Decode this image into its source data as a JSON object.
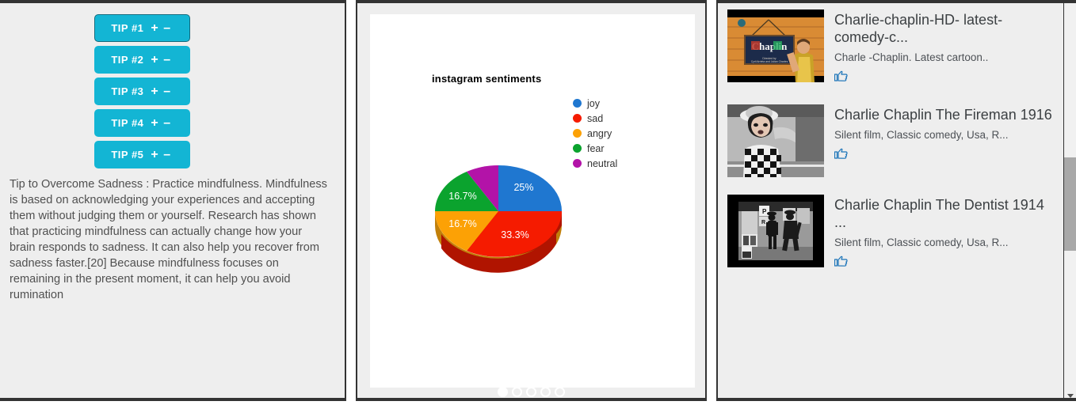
{
  "left_panel": {
    "tip_buttons": [
      {
        "label": "TIP #1",
        "plus": "+",
        "minus": "–",
        "focused": true
      },
      {
        "label": "TIP #2",
        "plus": "+",
        "minus": "–",
        "focused": false
      },
      {
        "label": "TIP #3",
        "plus": "+",
        "minus": "–",
        "focused": false
      },
      {
        "label": "TIP #4",
        "plus": "+",
        "minus": "–",
        "focused": false
      },
      {
        "label": "TIP #5",
        "plus": "+",
        "minus": "–",
        "focused": false
      }
    ],
    "tip_text": "Tip to Overcome Sadness : Practice mindfulness. Mindfulness is based on acknowledging your experiences and accepting them without judging them or yourself. Research has shown that practicing mindfulness can actually change how your brain responds to sadness. It can also help you recover from sadness faster.[20] Because mindfulness focuses on remaining in the present moment, it can help you avoid rumination",
    "accent_color": "#13b5d4"
  },
  "chart_data": {
    "type": "pie",
    "title": "instagram sentiments",
    "xlabel": "",
    "ylabel": "",
    "legend_position": "right",
    "three_d": true,
    "categories": [
      "joy",
      "sad",
      "angry",
      "fear",
      "neutral"
    ],
    "values": [
      25,
      33.3,
      16.7,
      16.7,
      8.3
    ],
    "value_labels": [
      "25%",
      "33.3%",
      "16.7%",
      "16.7%",
      ""
    ],
    "colors": [
      "#1f77d0",
      "#f51b00",
      "#fca105",
      "#0ba32e",
      "#b313a8"
    ],
    "slices": [
      {
        "name": "joy",
        "percent": 25.0,
        "label": "25%",
        "color": "#1f77d0"
      },
      {
        "name": "sad",
        "percent": 33.3,
        "label": "33.3%",
        "color": "#f51b00"
      },
      {
        "name": "angry",
        "percent": 16.7,
        "label": "16.7%",
        "color": "#fca105"
      },
      {
        "name": "fear",
        "percent": 16.7,
        "label": "16.7%",
        "color": "#0ba32e"
      },
      {
        "name": "neutral",
        "percent": 8.3,
        "label": "",
        "color": "#b313a8"
      }
    ]
  },
  "carousel": {
    "total_dots": 5,
    "active_index": 0
  },
  "right_panel": {
    "videos": [
      {
        "title": "Charlie-chaplin-HD- latest-comedy-c...",
        "description": "Charle -Chaplin. Latest cartoon..",
        "like_icon": "thumbs-up-icon",
        "thumb_kind": "chaplin-sign",
        "thumb_caption": "Chaplin"
      },
      {
        "title": "Charlie Chaplin The Fireman 1916",
        "description": "Silent film, Classic comedy, Usa, R...",
        "like_icon": "thumbs-up-icon",
        "thumb_kind": "bw-portrait",
        "thumb_caption": ""
      },
      {
        "title": "Charlie Chaplin The Dentist 1914 ...",
        "description": "Silent film, Classic comedy, Usa, R...",
        "like_icon": "thumbs-up-icon",
        "thumb_kind": "bw-street",
        "thumb_caption": ""
      }
    ],
    "like_glyph": "👉"
  },
  "scrollbar": {
    "orientation": "vertical",
    "thumb_color": "#a8a8a8"
  }
}
